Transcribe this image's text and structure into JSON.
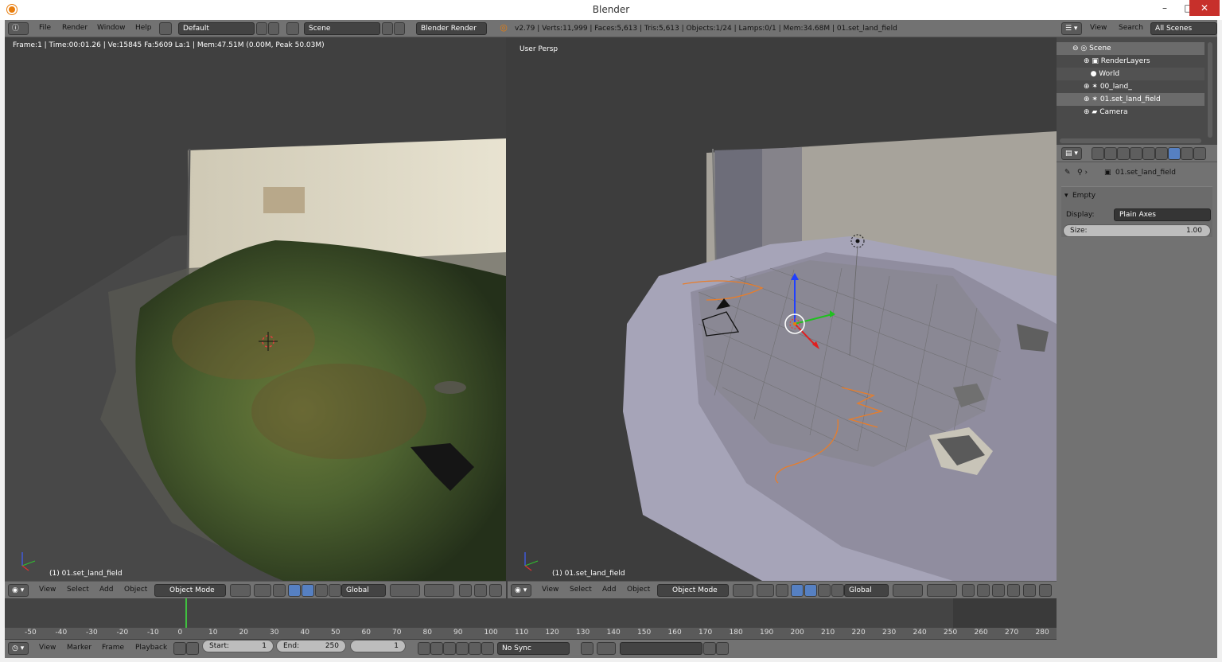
{
  "window": {
    "title": "Blender",
    "minimize": "–",
    "maximize": "□",
    "close": "✕"
  },
  "top_header": {
    "menus": [
      "File",
      "Render",
      "Window",
      "Help"
    ],
    "layout": "Default",
    "scene": "Scene",
    "engine": "Blender Render",
    "stats": "v2.79 | Verts:11,999 | Faces:5,613 | Tris:5,613 | Objects:1/24 | Lamps:0/1 | Mem:34.68M | 01.set_land_field"
  },
  "left_viewport": {
    "info": "Frame:1 | Time:00:01.26 | Ve:15845 Fa:5609 La:1 | Mem:47.51M (0.00M, Peak 50.03M)",
    "object_label": "(1) 01.set_land_field",
    "header": {
      "menus": [
        "View",
        "Select",
        "Add",
        "Object"
      ],
      "mode": "Object Mode",
      "orientation": "Global"
    }
  },
  "right_viewport": {
    "info": "User Persp",
    "object_label": "(1) 01.set_land_field",
    "header": {
      "menus": [
        "View",
        "Select",
        "Add",
        "Object"
      ],
      "mode": "Object Mode",
      "orientation": "Global"
    }
  },
  "timeline": {
    "ticks": [
      "-50",
      "-40",
      "-30",
      "-20",
      "-10",
      "0",
      "10",
      "20",
      "30",
      "40",
      "50",
      "60",
      "70",
      "80",
      "90",
      "100",
      "110",
      "120",
      "130",
      "140",
      "150",
      "160",
      "170",
      "180",
      "190",
      "200",
      "210",
      "220",
      "230",
      "240",
      "250",
      "260",
      "270",
      "280"
    ],
    "menus": [
      "View",
      "Marker",
      "Frame",
      "Playback"
    ],
    "start_label": "Start:",
    "start_value": "1",
    "end_label": "End:",
    "end_value": "250",
    "current_frame": "1",
    "sync": "No Sync"
  },
  "outliner": {
    "menus": [
      "View",
      "Search"
    ],
    "filter": "All Scenes",
    "items": [
      {
        "label": "Scene",
        "indent": 0
      },
      {
        "label": "RenderLayers",
        "indent": 1
      },
      {
        "label": "World",
        "indent": 1
      },
      {
        "label": "00_land_",
        "indent": 1
      },
      {
        "label": "01.set_land_field",
        "indent": 1
      },
      {
        "label": "Camera",
        "indent": 1
      }
    ]
  },
  "properties": {
    "breadcrumb": "01.set_land_field",
    "panel_title": "Empty",
    "display_label": "Display:",
    "display_value": "Plain Axes",
    "size_label": "Size:",
    "size_value": "1.00"
  },
  "colors": {
    "header": "#727272",
    "viewport_bg": "#3d3d3d",
    "selection_orange": "#e87d0d",
    "grass": "#4f6a2a",
    "solid_mesh": "#9a98a8"
  }
}
